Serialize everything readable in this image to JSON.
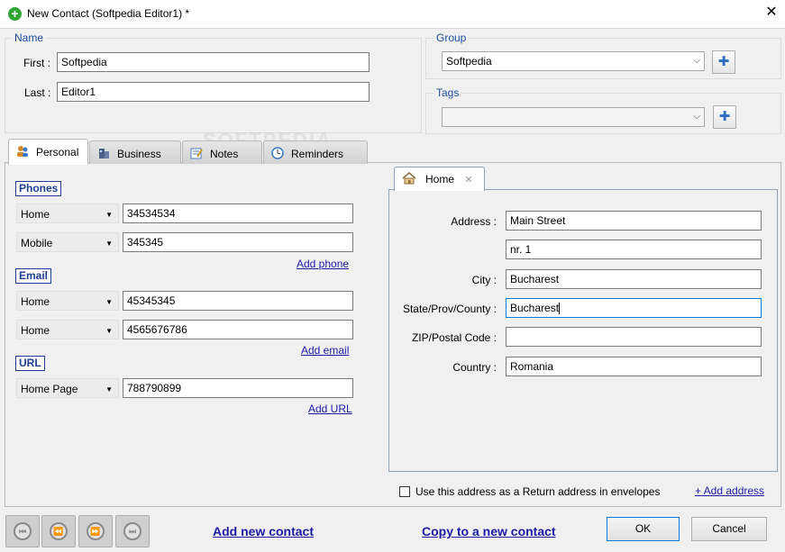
{
  "window": {
    "title": "New Contact (Softpedia Editor1) *",
    "close_glyph": "✕"
  },
  "name_group": {
    "label": "Name",
    "first_label": "First :",
    "first_value": "Softpedia",
    "last_label": "Last :",
    "last_value": "Editor1"
  },
  "group_group": {
    "label": "Group",
    "selected": "Softpedia",
    "add_glyph": "✚"
  },
  "tags_group": {
    "label": "Tags",
    "selected": "",
    "add_glyph": "✚"
  },
  "tabs": [
    {
      "label": "Personal",
      "icon": "people-icon",
      "active": true
    },
    {
      "label": "Business",
      "icon": "business-icon",
      "active": false
    },
    {
      "label": "Notes",
      "icon": "notes-icon",
      "active": false
    },
    {
      "label": "Reminders",
      "icon": "clock-icon",
      "active": false
    }
  ],
  "watermark": "SOFTPEDIA",
  "phones": {
    "title": "Phones",
    "rows": [
      {
        "type": "Home",
        "value": "34534534"
      },
      {
        "type": "Mobile",
        "value": "345345"
      }
    ],
    "add_link": "Add phone"
  },
  "email": {
    "title": "Email",
    "rows": [
      {
        "type": "Home",
        "value": "45345345"
      },
      {
        "type": "Home",
        "value": "4565676786"
      }
    ],
    "add_link": "Add email"
  },
  "url": {
    "title": "URL",
    "rows": [
      {
        "type": "Home Page",
        "value": "788790899"
      }
    ],
    "add_link": "Add URL"
  },
  "address": {
    "tab_label": "Home",
    "tab_close": "✕",
    "address_label": "Address :",
    "address_line1": "Main Street",
    "address_line2": "nr. 1",
    "city_label": "City :",
    "city_value": "Bucharest",
    "state_label": "State/Prov/County :",
    "state_value": "Bucharest",
    "zip_label": "ZIP/Postal Code :",
    "zip_value": "",
    "country_label": "Country :",
    "country_value": "Romania"
  },
  "return_address": {
    "label": "Use this address as a Return address in envelopes",
    "checked": false
  },
  "add_address_link": "+ Add address ",
  "footer": {
    "add_new_contact": "Add new contact",
    "copy_to_new": "Copy to a new contact",
    "ok": "OK",
    "cancel": "Cancel",
    "nav_first": "⏮",
    "nav_prev": "⏪",
    "nav_next": "⏩",
    "nav_last": "⏭"
  },
  "colors": {
    "accent": "#1c4d9c",
    "link": "#1b1ba6",
    "focus": "#0078d7"
  }
}
